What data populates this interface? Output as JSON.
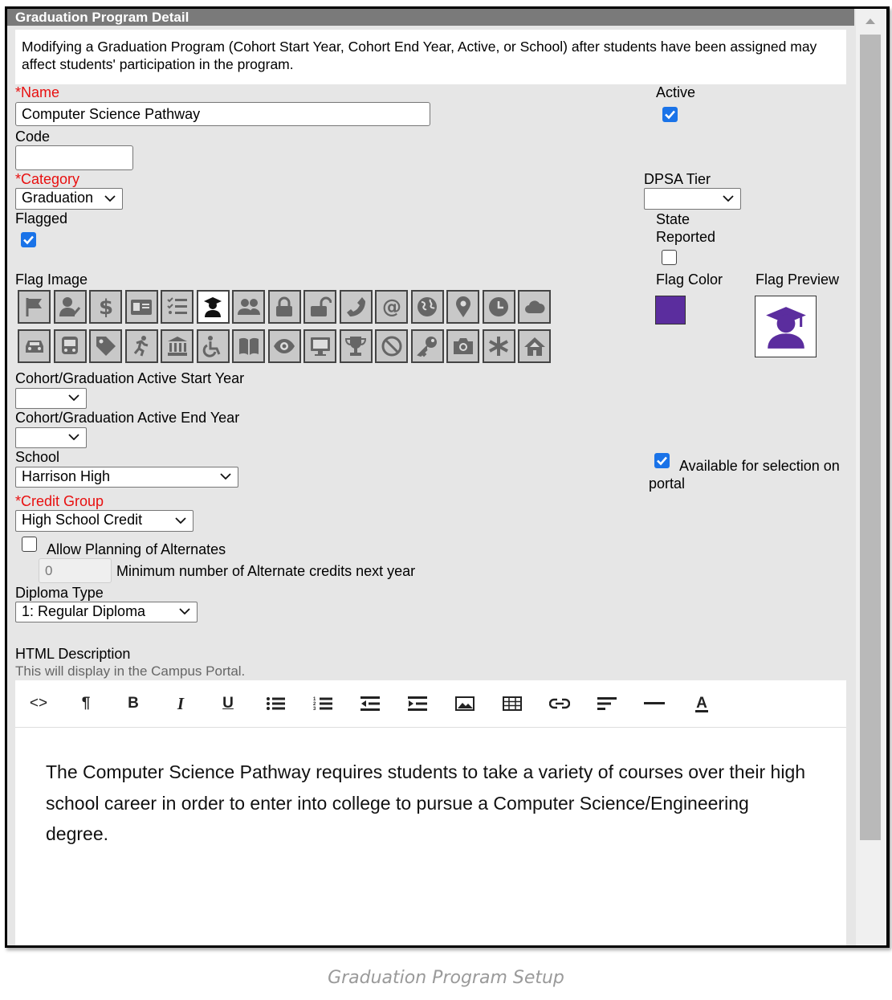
{
  "panel": {
    "title": "Graduation Program Detail",
    "notice": "Modifying a Graduation Program (Cohort Start Year, Cohort End Year, Active, or School) after students have been assigned may affect students' participation in the program."
  },
  "fields": {
    "name_req": "*",
    "name_label": "Name",
    "name_value": "Computer Science Pathway",
    "active_label": "Active",
    "active_checked": true,
    "code_label": "Code",
    "code_value": "",
    "category_req": "*",
    "category_label": "Category",
    "category_value": "Graduation",
    "dpsa_label": "DPSA Tier",
    "dpsa_value": "",
    "flagged_label": "Flagged",
    "flagged_checked": true,
    "state_reported_label_1": "State",
    "state_reported_label_2": "Reported",
    "state_reported_checked": false,
    "flag_image_label": "Flag Image",
    "flag_color_label": "Flag Color",
    "flag_color_value": "#5b2d9e",
    "flag_preview_label": "Flag Preview",
    "cohort_start_label": "Cohort/Graduation Active Start Year",
    "cohort_start_value": "",
    "cohort_end_label": "Cohort/Graduation Active End Year",
    "cohort_end_value": "",
    "school_label": "School",
    "school_value": "Harrison High",
    "portal_label_1": "Available for selection on",
    "portal_label_2": "portal",
    "portal_checked": true,
    "credit_group_req": "*",
    "credit_group_label": "Credit Group",
    "credit_group_value": "High School Credit",
    "alternates_label": "Allow Planning of Alternates",
    "alternates_checked": false,
    "min_alt_value": "0",
    "min_alt_label": "Minimum number of Alternate credits next year",
    "diploma_label": "Diploma Type",
    "diploma_value": "1: Regular Diploma",
    "html_desc_label": "HTML Description",
    "html_desc_hint": "This will display in the Campus Portal."
  },
  "flag_icons_row1": [
    "flag-icon",
    "user-check-icon",
    "dollar-icon",
    "id-card-icon",
    "checklist-icon",
    "graduate-icon",
    "users-icon",
    "lock-icon",
    "unlock-icon",
    "phone-icon",
    "at-icon",
    "globe-icon",
    "map-pin-icon",
    "clock-icon",
    "cloud-icon"
  ],
  "flag_icons_row2": [
    "car-icon",
    "bus-icon",
    "tag-icon",
    "running-icon",
    "institution-icon",
    "wheelchair-icon",
    "book-icon",
    "eye-icon",
    "monitor-icon",
    "trophy-icon",
    "ban-icon",
    "key-icon",
    "camera-icon",
    "asterisk-icon",
    "home-icon"
  ],
  "selected_flag_icon": "graduate-icon",
  "toolbar": {
    "code": "<>",
    "paragraph": "¶",
    "bold": "B",
    "italic": "I",
    "underline": "U"
  },
  "editor": {
    "content": "The Computer Science Pathway requires students to take a variety of courses over their high school career in order to enter into college to pursue a Computer Science/Engineering degree."
  },
  "caption": "Graduation Program Setup"
}
